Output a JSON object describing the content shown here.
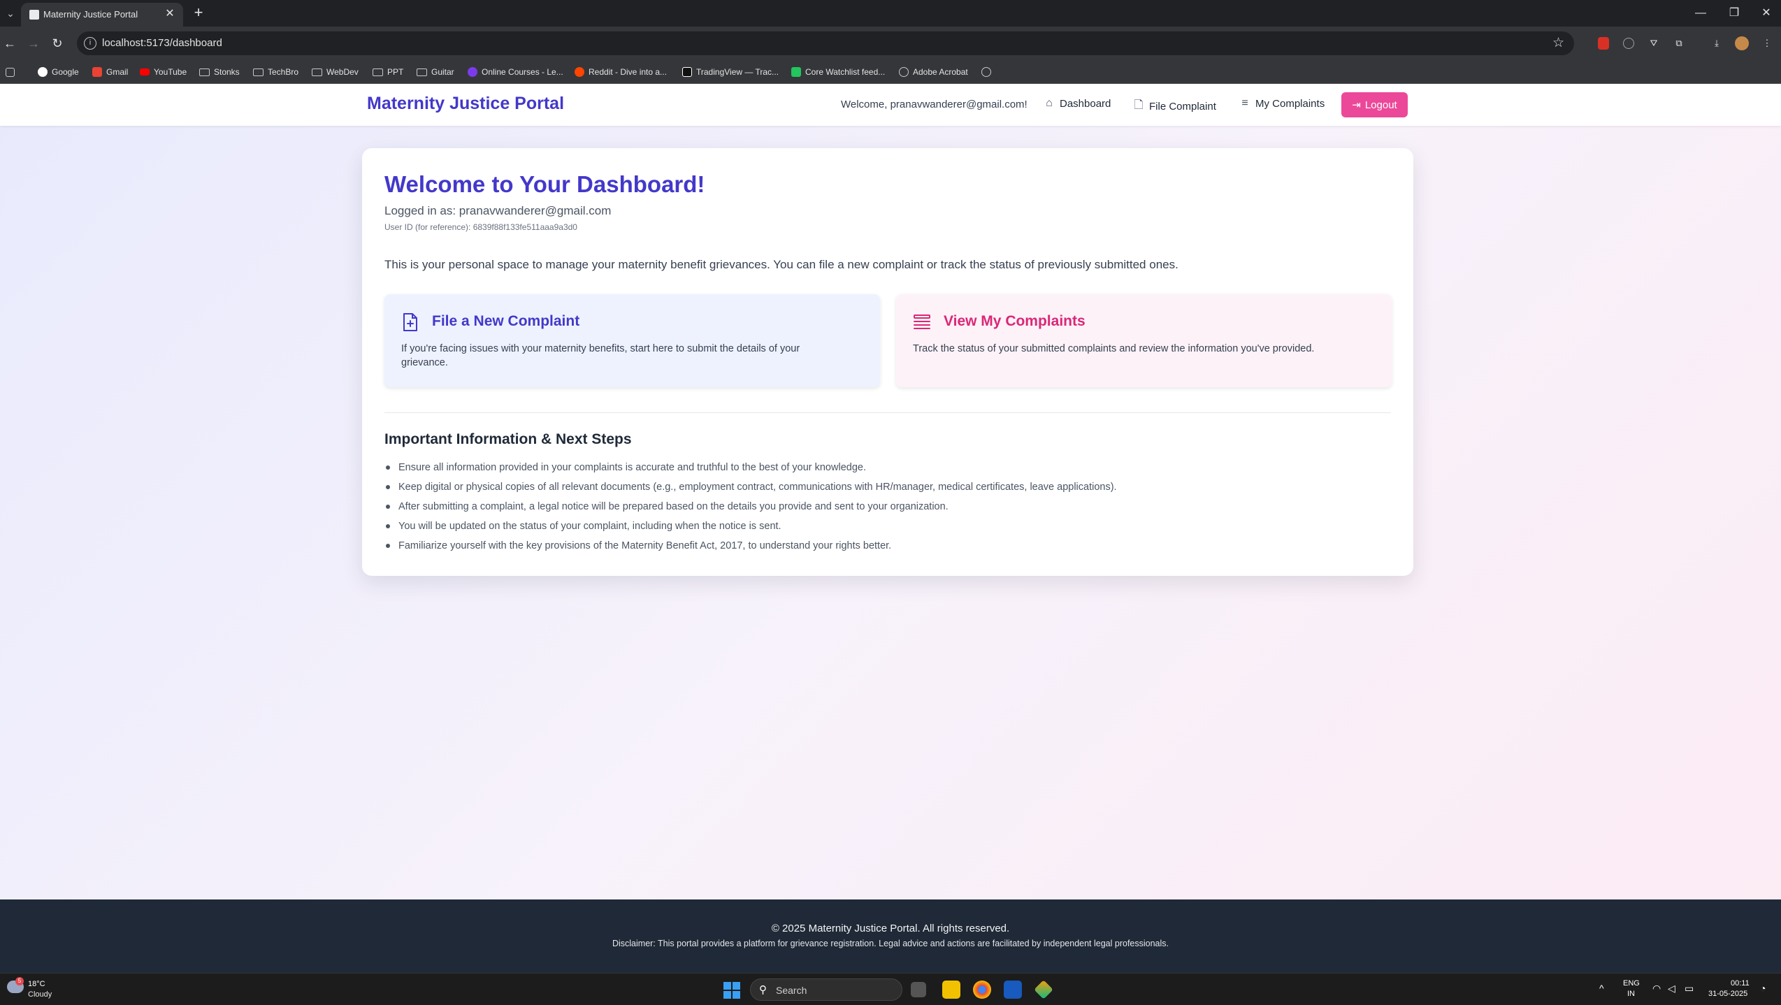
{
  "browser": {
    "tab_title": "Maternity Justice Portal",
    "url": "localhost:5173/dashboard",
    "bookmarks": [
      "Google",
      "Gmail",
      "YouTube",
      "Stonks",
      "TechBro",
      "WebDev",
      "PPT",
      "Guitar",
      "Online Courses - Le...",
      "Reddit - Dive into a...",
      "TradingView — Trac...",
      "Core Watchlist feed...",
      "Adobe Acrobat"
    ]
  },
  "navbar": {
    "brand": "Maternity Justice Portal",
    "welcome": "Welcome, pranavwanderer@gmail.com!",
    "links": {
      "dashboard": "Dashboard",
      "file_complaint": "File Complaint",
      "my_complaints": "My Complaints"
    },
    "logout": "Logout"
  },
  "dashboard": {
    "title": "Welcome to Your Dashboard!",
    "logged_in_as": "Logged in as: pranavwanderer@gmail.com",
    "user_id": "User ID (for reference): 6839f88f133fe511aaa9a3d0",
    "intro": "This is your personal space to manage your maternity benefit grievances. You can file a new complaint or track the status of previously submitted ones.",
    "actions": [
      {
        "title": "File a New Complaint",
        "description": "If you're facing issues with your maternity benefits, start here to submit the details of your grievance.",
        "icon": "file-plus-icon",
        "color": "#4338ca"
      },
      {
        "title": "View My Complaints",
        "description": "Track the status of your submitted complaints and review the information you've provided.",
        "icon": "list-icon",
        "color": "#db2777"
      }
    ],
    "info_title": "Important Information & Next Steps",
    "info_items": [
      "Ensure all information provided in your complaints is accurate and truthful to the best of your knowledge.",
      "Keep digital or physical copies of all relevant documents (e.g., employment contract, communications with HR/manager, medical certificates, leave applications).",
      "After submitting a complaint, a legal notice will be prepared based on the details you provide and sent to your organization.",
      "You will be updated on the status of your complaint, including when the notice is sent.",
      "Familiarize yourself with the key provisions of the Maternity Benefit Act, 2017, to understand your rights better."
    ]
  },
  "footer": {
    "copyright": "© 2025 Maternity Justice Portal. All rights reserved.",
    "disclaimer": "Disclaimer: This portal provides a platform for grievance registration. Legal advice and actions are facilitated by independent legal professionals."
  },
  "taskbar": {
    "weather_badge": "5",
    "temperature": "18°C",
    "weather": "Cloudy",
    "search_label": "Search",
    "lang": "ENG",
    "region": "IN",
    "time": "00:11",
    "date": "31-05-2025"
  },
  "colors": {
    "brand": "#4338ca",
    "accent_pink": "#ec4899",
    "footer_bg": "#1f2937"
  }
}
